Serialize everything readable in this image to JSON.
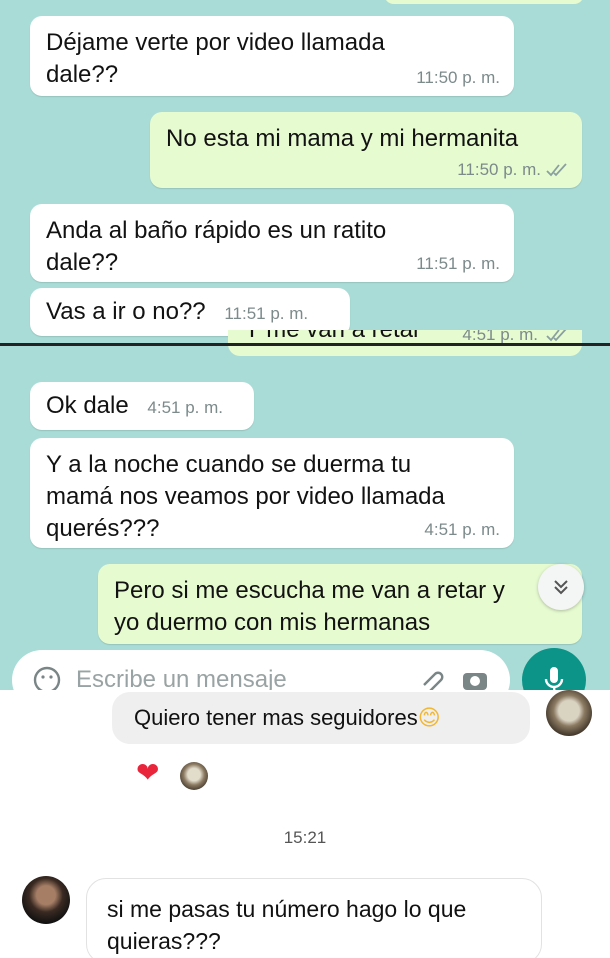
{
  "whatsapp": {
    "messages": [
      {
        "dir": "in",
        "text": "Déjame verte por video llamada\ndale??",
        "time": "11:50 p. m."
      },
      {
        "dir": "out",
        "text": "No esta mi mama y mi hermanita",
        "time": "11:50 p. m."
      },
      {
        "dir": "in",
        "text": "Anda al baño rápido es un ratito\ndale??",
        "time": "11:51 p. m."
      },
      {
        "dir": "in",
        "text": "Vas a ir o no??",
        "time": "11:51 p. m."
      },
      {
        "dir": "in",
        "text": "Ok dale",
        "time": "4:51 p. m."
      },
      {
        "dir": "in",
        "text": "Y a la noche cuando se duerma tu\nmamá nos veamos por video llamada\nquerés???",
        "time": "4:51 p. m."
      },
      {
        "dir": "out",
        "text": "Pero si me escucha me van a retar y\nyo duermo con mis hermanas",
        "time": ""
      }
    ],
    "cut_message": {
      "text": "Y me van a retar",
      "time": "4:51 p. m."
    },
    "input_placeholder": "Escribe un mensaje",
    "colors": {
      "background": "#a9dcd6",
      "incoming": "#ffffff",
      "outgoing": "#e7fbd1",
      "accent": "#0c9488"
    },
    "icons": [
      "emoji-icon",
      "attach-icon",
      "camera-icon",
      "mic-icon",
      "double-chevron-down-icon",
      "double-check-icon"
    ]
  },
  "instagram": {
    "sent_message": "Quiero tener mas seguidores",
    "sent_emoji": "😊",
    "reaction_emoji": "❤",
    "timestamp": "15:21",
    "received_message": "si me pasas tu número hago lo que\nquieras???",
    "colors": {
      "bubble": "#efefef",
      "heart": "#e8253b"
    }
  }
}
